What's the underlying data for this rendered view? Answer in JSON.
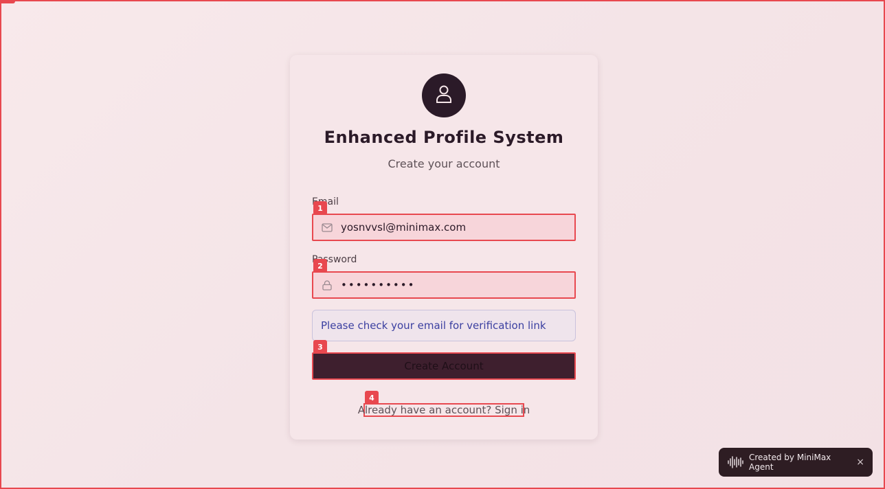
{
  "app": {
    "title": "Enhanced Profile System",
    "subtitle": "Create your account"
  },
  "form": {
    "email_label": "Email",
    "email_value": "yosnvvsl@minimax.com",
    "password_label": "Password",
    "password_value": "••••••••••",
    "notice": "Please check your email for verification link",
    "submit_label": "Create Account",
    "signin_link": "Already have an account? Sign in"
  },
  "annotations": {
    "badge_1": "1",
    "badge_2": "2",
    "badge_3": "3",
    "badge_4": "4"
  },
  "toast": {
    "text": "Created by MiniMax Agent",
    "close": "×"
  },
  "icons": {
    "avatar": "user-icon",
    "email": "mail-icon",
    "password": "lock-icon",
    "toast": "waveform-icon"
  },
  "colors": {
    "accent": "#e8484f",
    "primary": "#2b1a28",
    "notice_text": "#3a3fa0"
  }
}
